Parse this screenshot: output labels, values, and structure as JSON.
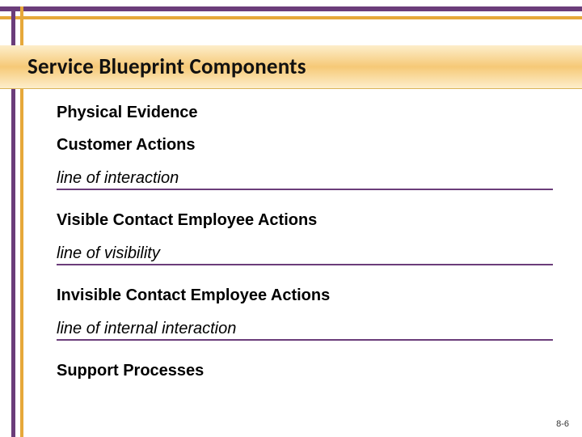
{
  "colors": {
    "purple": "#6b3d7a",
    "gold": "#e6a83a"
  },
  "title": "Service Blueprint Components",
  "rows": {
    "physical_evidence": "Physical Evidence",
    "customer_actions": "Customer Actions",
    "line_interaction": "line of interaction",
    "visible_contact": "Visible Contact Employee Actions",
    "line_visibility": "line of visibility",
    "invisible_contact": "Invisible Contact Employee Actions",
    "line_internal": "line of internal interaction",
    "support_processes": "Support Processes"
  },
  "page_number": "8-6"
}
